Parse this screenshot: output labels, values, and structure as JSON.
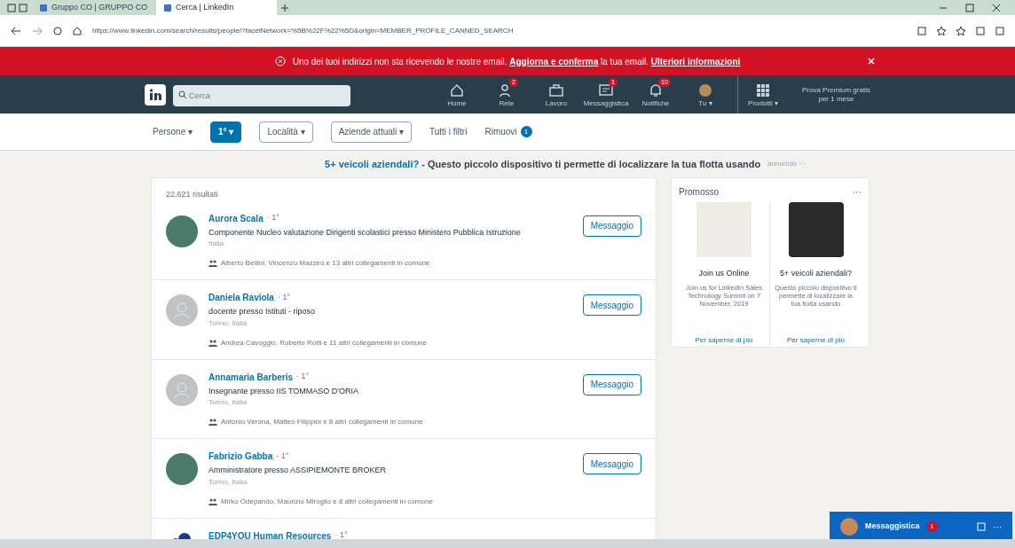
{
  "browser": {
    "tabs": [
      {
        "title": "Gruppo CO | GRUPPO CO",
        "selected": false
      },
      {
        "title": "Cerca | LinkedIn",
        "selected": true
      }
    ],
    "url": "https://www.linkedin.com/search/results/people/?facetNetwork=%5B%22F%22%5D&origin=MEMBER_PROFILE_CANNED_SEARCH"
  },
  "banner": {
    "text": "Uno dei tuoi indirizzi non sta ricevendo le nostre email. **Aggiorna e conferma** la tua email. **Ulteriori informazioni**"
  },
  "nav": {
    "search_placeholder": "Cerca",
    "items": [
      {
        "label": "Home"
      },
      {
        "label": "Rete",
        "badge": "2"
      },
      {
        "label": "Lavoro"
      },
      {
        "label": "Messaggistica",
        "badge": "1"
      },
      {
        "label": "Notifiche",
        "badge": "10"
      },
      {
        "label": "Tu ▾"
      },
      {
        "label": "Prodotti ▾"
      }
    ],
    "premium": [
      "Prova Premium gratis",
      "per 1 mese"
    ]
  },
  "filters": [
    {
      "label": "Persone ▾",
      "kind": "plain",
      "selected": false
    },
    {
      "label": "1° ▾",
      "kind": "box",
      "selected": true
    },
    {
      "label": "Località ▾",
      "kind": "box",
      "selected": false
    },
    {
      "label": "Aziende attuali ▾",
      "kind": "box",
      "selected": false
    },
    {
      "label": "Tutti i filtri",
      "kind": "plain",
      "selected": false
    },
    {
      "label": "Rimuovi",
      "kind": "count",
      "count": "1",
      "selected": false
    }
  ],
  "ad_line": {
    "link": "5+ veicoli aziendali?",
    "text": " - Questo piccolo dispositivo ti permette di localizzare la tua flotta usando",
    "tag": "annuncio ···"
  },
  "results": {
    "count": "22.621 risultati",
    "people": [
      {
        "name": "Aurora Scala",
        "degree": "· 1°",
        "headline": "Componente Nucleo valutazione Dirigenti scolastici presso Ministero Pubblica Istruzione",
        "location": "Italia",
        "shared": "Alberto Bellini, Vincenzo Mazzeo e 13 altri collegamenti in comune",
        "kind": "photo",
        "action": "Messaggio"
      },
      {
        "name": "Daniela Raviola",
        "degree": "· 1°",
        "headline": "docente presso Istituti - riposo",
        "location": "Torino, Italia",
        "shared": "Andrea Cavoggio, Roberto Rotti e 11 altri collegamenti in comune",
        "kind": "placeholder",
        "action": "Messaggio"
      },
      {
        "name": "Annamaria Barberis",
        "degree": "· 1°",
        "headline": "Insegnante presso IIS TOMMASO D'ORIA",
        "location": "Torino, Italia",
        "shared": "Antonio Verona, Matteo Filippini e 8 altri collegamenti in comune",
        "kind": "placeholder",
        "action": "Messaggio"
      },
      {
        "name": "Fabrizio Gabba",
        "degree": "· 1°",
        "headline": "Amministratore presso ASSIPIEMONTE BROKER",
        "location": "Torino, Italia",
        "shared": "Mirko Odepando, Maurizio Miroglio e 8 altri collegamenti in comune",
        "kind": "photo",
        "action": "Messaggio"
      },
      {
        "name": "EDP4YOU Human Resources",
        "degree": "· 1°",
        "kind": "logo"
      }
    ]
  },
  "promoted": {
    "title": "Promosso",
    "more": "···",
    "ads": [
      {
        "title": "Join us Online",
        "text": "Join us for LinkedIn Sales Technology Summit on 7 November, 2019",
        "link": "Per saperne di più",
        "kind": "logo"
      },
      {
        "title": "5+ veicoli aziendali?",
        "text": "Questo piccolo dispositivo ti permette di localizzare la tua flotta usando",
        "link": "Per saperne di più",
        "kind": "photo"
      }
    ]
  },
  "messaging": {
    "label": "Messaggistica",
    "badge": "1",
    "more": "···"
  }
}
